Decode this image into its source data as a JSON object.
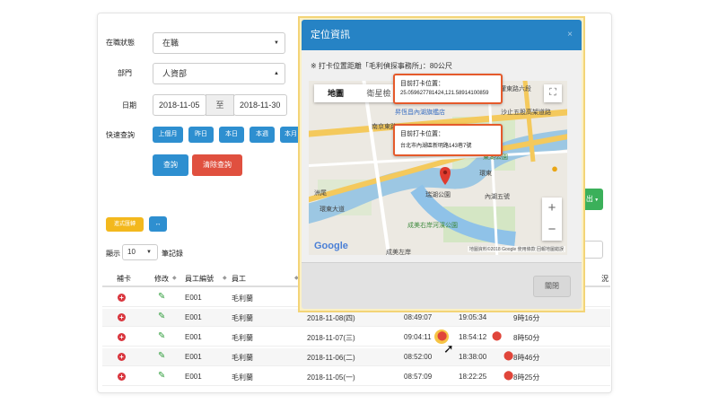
{
  "filters": {
    "status_label": "在職狀態",
    "status_value": "在職",
    "dept_label": "部門",
    "dept_value": "人資部",
    "date_label": "日期",
    "date_from": "2018-11-05",
    "date_sep": "至",
    "date_to": "2018-11-30",
    "quick_label": "快速查詢",
    "quick_buttons": [
      "上個月",
      "昨日",
      "本日",
      "本週",
      "本月"
    ],
    "search_button": "查詢",
    "clear_button": "清除查詢",
    "export_partial": "出"
  },
  "toolbar": {
    "yellow_button": "進式匯轉",
    "expand_icon": "↔"
  },
  "pagination": {
    "show_label": "顯示",
    "page_size": "10",
    "records_label": "筆記錄"
  },
  "table": {
    "headers": [
      "補卡",
      "修改",
      "員工編號",
      "員工",
      "",
      "",
      "",
      "況"
    ],
    "rows": [
      {
        "id": "E001",
        "name": "毛利蘭",
        "date": "",
        "in": "",
        "out": "",
        "hours": "",
        "pin_in": false,
        "pin_out": false
      },
      {
        "id": "E001",
        "name": "毛利蘭",
        "date": "2018-11-08(四)",
        "in": "08:49:07",
        "out": "19:05:34",
        "hours": "9時16分",
        "pin_in": false,
        "pin_out": false
      },
      {
        "id": "E001",
        "name": "毛利蘭",
        "date": "2018-11-07(三)",
        "in": "09:04:11",
        "out": "18:54:12",
        "hours": "8時50分",
        "pin_in": true,
        "pin_out": true
      },
      {
        "id": "E001",
        "name": "毛利蘭",
        "date": "2018-11-06(二)",
        "in": "08:52:00",
        "out": "18:38:00",
        "hours": "8時46分",
        "pin_in": false,
        "pin_out": true
      },
      {
        "id": "E001",
        "name": "毛利蘭",
        "date": "2018-11-05(一)",
        "in": "08:57:09",
        "out": "18:22:25",
        "hours": "8時25分",
        "pin_in": false,
        "pin_out": true
      }
    ]
  },
  "modal": {
    "title": "定位資訊",
    "close_x": "×",
    "note": "※ 打卡位置距離「毛利偵探事務所」：80公尺",
    "close_button": "關閉",
    "map": {
      "type_map": "地圖",
      "type_satellite": "衛星檢",
      "fullscreen_icon": "⛶",
      "zoom_in": "+",
      "zoom_out": "−",
      "google": "Google",
      "attribution": "地圖資料©2018 Google  使用條款  回報地圖錯誤",
      "callout1_title": "目前打卡位置：",
      "callout1_value": "25.059627781424,121.58914100859",
      "callout2_title": "目前打卡位置：",
      "callout2_value": "台北市內湖區新明路143巷7號",
      "labels": [
        "昇恆昌內湖旗艦店",
        "南京東路",
        "沙止五股高架道路",
        "環東大道",
        "成美右岸河濱公園",
        "成美左岸",
        "環東",
        "內湖五號",
        "瑞湖公園",
        "洲尾",
        "東湖公園",
        "民權東路六段"
      ]
    }
  }
}
